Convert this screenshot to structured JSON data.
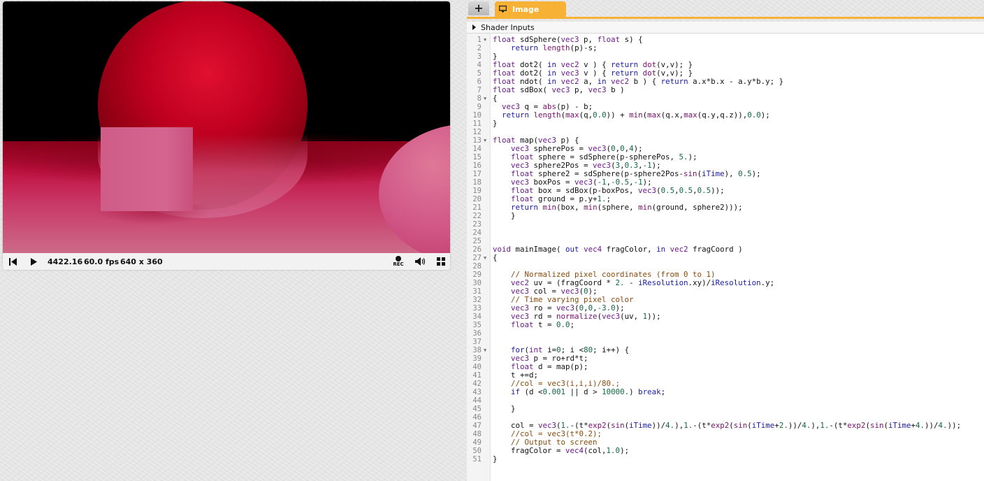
{
  "player": {
    "time": "4422.16",
    "fps": "60.0 fps",
    "resolution": "640 x 360",
    "rec_label": "REC",
    "icons": [
      "rewind-icon",
      "play-icon",
      "record-icon",
      "volume-icon",
      "fullscreen-icon"
    ]
  },
  "tabs": {
    "add_label": "+",
    "image_label": "Image",
    "accent_color": "#f7b235"
  },
  "shader_inputs": {
    "label": "Shader Inputs"
  },
  "editor": {
    "lines": [
      {
        "n": "1",
        "fold": true,
        "h": "<span class='t'>float</span> sdSphere(<span class='t'>vec3</span> p, <span class='t'>float</span> s) {"
      },
      {
        "n": "2",
        "fold": false,
        "h": "    <span class='k'>return</span> <span class='f'>length</span>(p)-s;"
      },
      {
        "n": "3",
        "fold": false,
        "h": "}"
      },
      {
        "n": "4",
        "fold": false,
        "h": "<span class='t'>float</span> dot2( <span class='k'>in</span> <span class='t'>vec2</span> v ) { <span class='k'>return</span> <span class='f'>dot</span>(v,v); }"
      },
      {
        "n": "5",
        "fold": false,
        "h": "<span class='t'>float</span> dot2( <span class='k'>in</span> <span class='t'>vec3</span> v ) { <span class='k'>return</span> <span class='f'>dot</span>(v,v); }"
      },
      {
        "n": "6",
        "fold": false,
        "h": "<span class='t'>float</span> ndot( <span class='k'>in</span> <span class='t'>vec2</span> a, <span class='k'>in</span> <span class='t'>vec2</span> b ) { <span class='k'>return</span> a.x*b.x - a.y*b.y; }"
      },
      {
        "n": "7",
        "fold": false,
        "h": "<span class='t'>float</span> sdBox( <span class='t'>vec3</span> p, <span class='t'>vec3</span> b )"
      },
      {
        "n": "8",
        "fold": true,
        "h": "{"
      },
      {
        "n": "9",
        "fold": false,
        "h": "  <span class='t'>vec3</span> q = <span class='f'>abs</span>(p) - b;"
      },
      {
        "n": "10",
        "fold": false,
        "h": "  <span class='k'>return</span> <span class='f'>length</span>(<span class='f'>max</span>(q,<span class='n'>0.0</span>)) + <span class='f'>min</span>(<span class='f'>max</span>(q.x,<span class='f'>max</span>(q.y,q.z)),<span class='n'>0.0</span>);"
      },
      {
        "n": "11",
        "fold": false,
        "h": "}"
      },
      {
        "n": "12",
        "fold": false,
        "h": ""
      },
      {
        "n": "13",
        "fold": true,
        "h": "<span class='t'>float</span> map(<span class='t'>vec3</span> p) {"
      },
      {
        "n": "14",
        "fold": false,
        "h": "    <span class='t'>vec3</span> spherePos = <span class='t'>vec3</span>(<span class='n'>0</span>,<span class='n'>0</span>,<span class='n'>4</span>);"
      },
      {
        "n": "15",
        "fold": false,
        "h": "    <span class='t'>float</span> sphere = sdSphere(p-spherePos, <span class='n'>5.</span>);"
      },
      {
        "n": "16",
        "fold": false,
        "h": "    <span class='t'>vec3</span> sphere2Pos = <span class='t'>vec3</span>(<span class='n'>3</span>,<span class='n'>0.3</span>,<span class='n'>-1</span>);"
      },
      {
        "n": "17",
        "fold": false,
        "h": "    <span class='t'>float</span> sphere2 = sdSphere(p-sphere2Pos-<span class='f'>sin</span>(<span class='k'>iTime</span>), <span class='n'>0.5</span>);"
      },
      {
        "n": "18",
        "fold": false,
        "h": "    <span class='t'>vec3</span> boxPos = <span class='t'>vec3</span>(<span class='n'>-1</span>,<span class='n'>-0.5</span>,<span class='n'>-1</span>);"
      },
      {
        "n": "19",
        "fold": false,
        "h": "    <span class='t'>float</span> box = sdBox(p-boxPos, <span class='t'>vec3</span>(<span class='n'>0.5</span>,<span class='n'>0.5</span>,<span class='n'>0.5</span>));"
      },
      {
        "n": "20",
        "fold": false,
        "h": "    <span class='t'>float</span> ground = p.y+<span class='n'>1.</span>;"
      },
      {
        "n": "21",
        "fold": false,
        "h": "    <span class='k'>return</span> <span class='f'>min</span>(box, <span class='f'>min</span>(sphere, <span class='f'>min</span>(ground, sphere2)));"
      },
      {
        "n": "22",
        "fold": false,
        "h": "    }"
      },
      {
        "n": "23",
        "fold": false,
        "h": ""
      },
      {
        "n": "24",
        "fold": false,
        "h": ""
      },
      {
        "n": "25",
        "fold": false,
        "h": ""
      },
      {
        "n": "26",
        "fold": false,
        "h": "<span class='t'>void</span> mainImage( <span class='k'>out</span> <span class='t'>vec4</span> fragColor, <span class='k'>in</span> <span class='t'>vec2</span> fragCoord )"
      },
      {
        "n": "27",
        "fold": true,
        "h": "{"
      },
      {
        "n": "28",
        "fold": false,
        "h": ""
      },
      {
        "n": "29",
        "fold": false,
        "h": "    <span class='c'>// Normalized pixel coordinates (from 0 to 1)</span>"
      },
      {
        "n": "30",
        "fold": false,
        "h": "    <span class='t'>vec2</span> uv = (fragCoord * <span class='n'>2.</span> - <span class='k'>iResolution</span>.xy)/<span class='k'>iResolution</span>.y;"
      },
      {
        "n": "31",
        "fold": false,
        "h": "    <span class='t'>vec3</span> col = <span class='t'>vec3</span>(<span class='n'>0</span>);"
      },
      {
        "n": "32",
        "fold": false,
        "h": "    <span class='c'>// Time varying pixel color</span>"
      },
      {
        "n": "33",
        "fold": false,
        "h": "    <span class='t'>vec3</span> ro = <span class='t'>vec3</span>(<span class='n'>0</span>,<span class='n'>0</span>,<span class='n'>-3.0</span>);"
      },
      {
        "n": "34",
        "fold": false,
        "h": "    <span class='t'>vec3</span> rd = <span class='f'>normalize</span>(<span class='t'>vec3</span>(uv, <span class='n'>1</span>));"
      },
      {
        "n": "35",
        "fold": false,
        "h": "    <span class='t'>float</span> t = <span class='n'>0.0</span>;"
      },
      {
        "n": "36",
        "fold": false,
        "h": ""
      },
      {
        "n": "37",
        "fold": false,
        "h": ""
      },
      {
        "n": "38",
        "fold": true,
        "h": "    <span class='k'>for</span>(<span class='t'>int</span> i=<span class='n'>0</span>; i &lt;<span class='n'>80</span>; i++) {"
      },
      {
        "n": "39",
        "fold": false,
        "h": "    <span class='t'>vec3</span> p = ro+rd*t;"
      },
      {
        "n": "40",
        "fold": false,
        "h": "    <span class='t'>float</span> d = map(p);"
      },
      {
        "n": "41",
        "fold": false,
        "h": "    t +=d;"
      },
      {
        "n": "42",
        "fold": false,
        "h": "    <span class='c'>//col = vec3(i,i,i)/80.;</span>"
      },
      {
        "n": "43",
        "fold": false,
        "h": "    <span class='k'>if</span> (d &lt;<span class='n'>0.001</span> || d &gt; <span class='n'>10000.</span>) <span class='k'>break</span>;"
      },
      {
        "n": "44",
        "fold": false,
        "h": ""
      },
      {
        "n": "45",
        "fold": false,
        "h": "    }"
      },
      {
        "n": "46",
        "fold": false,
        "h": ""
      },
      {
        "n": "47",
        "fold": false,
        "h": "    col = <span class='t'>vec3</span>(<span class='n'>1.</span>-(t*<span class='f'>exp2</span>(<span class='f'>sin</span>(<span class='k'>iTime</span>))/<span class='n'>4.</span>),<span class='n'>1.</span>-(t*<span class='f'>exp2</span>(<span class='f'>sin</span>(<span class='k'>iTime</span>+<span class='n'>2.</span>))/<span class='n'>4.</span>),<span class='n'>1.</span>-(t*<span class='f'>exp2</span>(<span class='f'>sin</span>(<span class='k'>iTime</span>+<span class='n'>4.</span>))/<span class='n'>4.</span>));"
      },
      {
        "n": "48",
        "fold": false,
        "h": "    <span class='c'>//col = vec3(t*0.2);</span>"
      },
      {
        "n": "49",
        "fold": false,
        "h": "    <span class='c'>// Output to screen</span>"
      },
      {
        "n": "50",
        "fold": false,
        "h": "    fragColor = <span class='t'>vec4</span>(col,<span class='n'>1.0</span>);"
      },
      {
        "n": "51",
        "fold": false,
        "h": "}"
      }
    ]
  }
}
